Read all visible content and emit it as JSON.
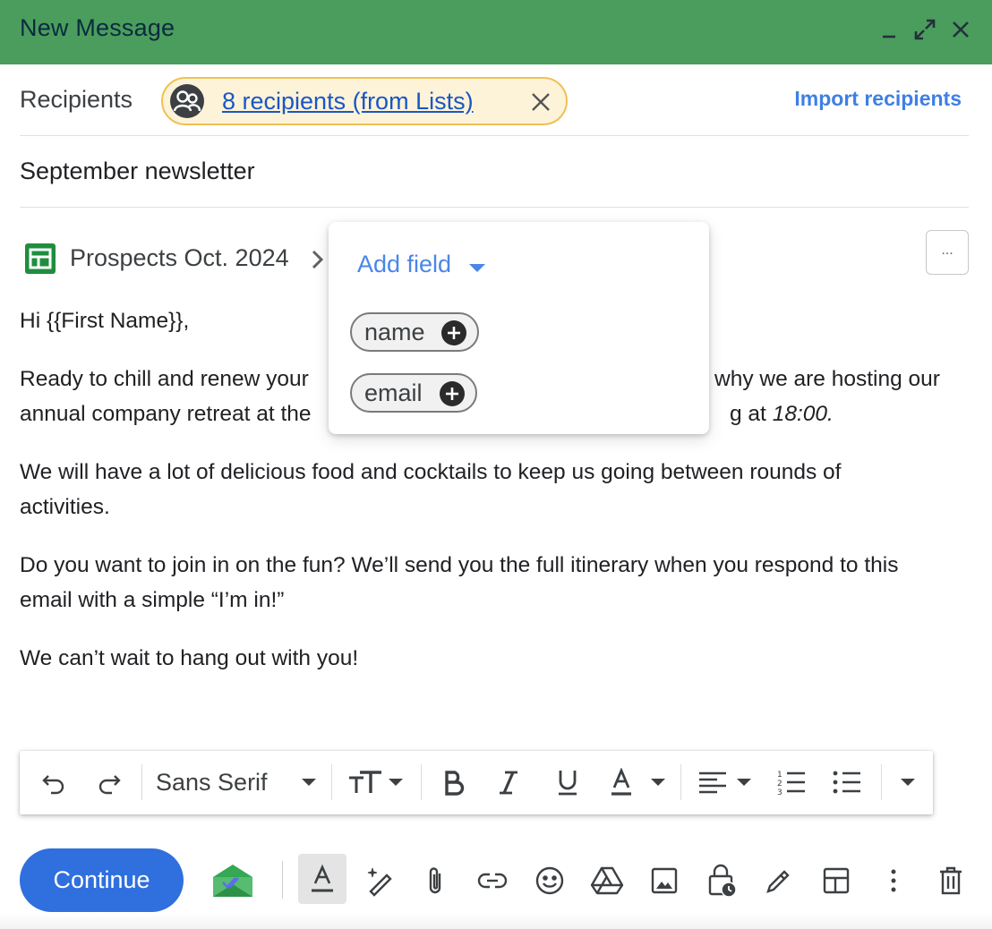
{
  "window": {
    "title": "New Message",
    "controls": [
      "minimize-icon",
      "expand-icon",
      "close-icon"
    ],
    "accent_color": "#4a9d5c"
  },
  "recipients": {
    "label": "Recipients",
    "chip_text": "8 recipients (from Lists)",
    "chip_icon": "group-icon",
    "import_label": "Import recipients"
  },
  "subject": "September newsletter",
  "sheet": {
    "name": "Prospects Oct. 2024",
    "icon": "sheets-icon",
    "more_label": "..."
  },
  "body": {
    "greeting": "Hi {{First Name}},",
    "p1_line1_left": "Ready to chill and renew your",
    "p1_line1_right": "why we are hosting our",
    "p1_line2_left": "annual company retreat at the",
    "p1_line2_right_plain": "g at ",
    "p1_line2_right_italic": "18:00.",
    "p2_line1": "We will have a lot of delicious food and cocktails to keep us going between rounds of",
    "p2_line2": "activities.",
    "p3_line1": "Do you want to join in on the fun? We’ll send you the full itinerary when you respond to this",
    "p3_line2": "email with a simple “I’m in!”",
    "p4": "We can’t wait to hang out with you!"
  },
  "popup": {
    "add_field_label": "Add field",
    "fields": [
      {
        "label": "name"
      },
      {
        "label": "email"
      }
    ]
  },
  "format_toolbar": {
    "font": "Sans Serif",
    "buttons": [
      "undo-icon",
      "redo-icon",
      "font-size-icon",
      "bold-icon",
      "italic-icon",
      "underline-icon",
      "text-color-icon",
      "align-icon",
      "numbered-list-icon",
      "bulleted-list-icon",
      "more-formatting-icon"
    ]
  },
  "bottom_bar": {
    "continue_label": "Continue",
    "continue_color": "#2f6fde",
    "icons": [
      "mailmeteor-icon",
      "formatting-options-icon",
      "magic-pen-icon",
      "attach-icon",
      "link-icon",
      "emoji-icon",
      "drive-icon",
      "photo-icon",
      "confidential-icon",
      "signature-icon",
      "template-icon",
      "more-options-icon",
      "trash-icon"
    ]
  }
}
